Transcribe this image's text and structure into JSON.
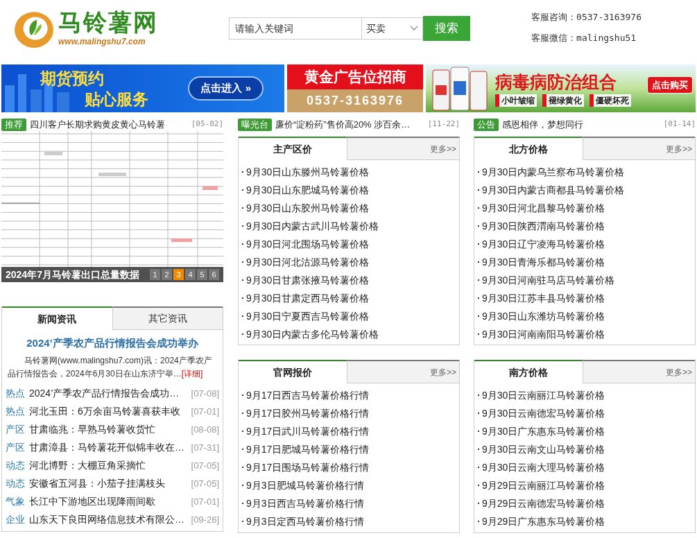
{
  "header": {
    "logo": {
      "name": "马铃薯网",
      "url": "www.malingshu7.com"
    },
    "search": {
      "placeholder": "请输入关键词",
      "category": "买卖",
      "button": "搜索"
    },
    "contact": [
      "客服咨询：0537-3163976",
      "客服微信：malingshu51"
    ]
  },
  "banners": [
    {
      "kind": "futures",
      "lines": [
        "期货预约",
        "贴心服务"
      ],
      "button": "点击进入 »"
    },
    {
      "kind": "ad",
      "title": "黄金广告位招商",
      "phone": "0537-3163976"
    },
    {
      "kind": "product",
      "title": "病毒病防治组合",
      "button": "点击购买",
      "tags": [
        "小叶皱缩",
        "褪绿黄化",
        "僵硬坏死"
      ]
    }
  ],
  "tickers": [
    {
      "tag": "推荐",
      "text": "四川客户长期求购黄皮黄心马铃薯",
      "date": "[05-02]"
    },
    {
      "tag": "曝光台",
      "text": "廉价“淀粉药”售价高20% 涉百余…",
      "date": "[11-22]"
    },
    {
      "tag": "公告",
      "text": "感恩相伴，梦想同行",
      "date": "[01-14]"
    }
  ],
  "slideshow": {
    "kind": "picture",
    "caption": "2024年7月马铃薯出口总量数据",
    "pages": [
      {
        "label": "1",
        "selected": false
      },
      {
        "label": "2",
        "selected": false
      },
      {
        "label": "3",
        "selected": true
      },
      {
        "label": "4",
        "selected": false
      },
      {
        "label": "5",
        "selected": false
      },
      {
        "label": "6",
        "selected": false
      }
    ]
  },
  "news_box": {
    "tabs": [
      {
        "label": "新闻资讯",
        "selected": true
      },
      {
        "label": "其它资讯",
        "selected": false
      }
    ],
    "headline": "2024’产季农产品行情报告会成功举办",
    "summary": "马铃薯网(www.malingshu7.com)讯：2024产季农产品行情报告会，2024年6月30日在山东济宁举…",
    "detail_link": "[详细]",
    "items": [
      {
        "tag": "热点",
        "title": "2024’产季农产品行情报告会成功…",
        "date": "[07-08]"
      },
      {
        "tag": "热点",
        "title": "河北玉田：6万余亩马铃薯喜获丰收",
        "date": "[07-01]"
      },
      {
        "tag": "产区",
        "title": "甘肃临兆：早熟马铃薯收货忙",
        "date": "[08-08]"
      },
      {
        "tag": "产区",
        "title": "甘肃漳县：马铃薯花开似锦丰收在…",
        "date": "[07-31]"
      },
      {
        "tag": "动态",
        "title": "河北博野：大棚豆角采摘忙",
        "date": "[07-05]"
      },
      {
        "tag": "动态",
        "title": "安徽省五河县：小茄子挂满枝头",
        "date": "[07-05]"
      },
      {
        "tag": "气象",
        "title": "长江中下游地区出现降雨间歇",
        "date": "[07-01]"
      },
      {
        "tag": "企业",
        "title": "山东天下良田网络信息技术有限公…",
        "date": "[09-26]"
      }
    ]
  },
  "price_panels": [
    {
      "title": "主产区价",
      "more": "更多>>",
      "items": [
        "9月30日山东滕州马铃薯价格",
        "9月30日山东肥城马铃薯价格",
        "9月30日山东胶州马铃薯价格",
        "9月30日内蒙古武川马铃薯价格",
        "9月30日河北围场马铃薯价格",
        "9月30日河北沽源马铃薯价格",
        "9月30日甘肃张掖马铃薯价格",
        "9月30日甘肃定西马铃薯价格",
        "9月30日宁夏西吉马铃薯价格",
        "9月30日内蒙古多伦马铃薯价格"
      ]
    },
    {
      "title": "北方价格",
      "more": "更多>>",
      "items": [
        "9月30日内蒙乌兰察布马铃薯价格",
        "9月30日内蒙古商都县马铃薯价格",
        "9月30日河北昌黎马铃薯价格",
        "9月30日陕西渭南马铃薯价格",
        "9月30日辽宁凌海马铃薯价格",
        "9月30日青海乐都马铃薯价格",
        "9月30日河南驻马店马铃薯价格",
        "9月30日江苏丰县马铃薯价格",
        "9月30日山东潍坊马铃薯价格",
        "9月30日河南南阳马铃薯价格"
      ]
    },
    {
      "title": "官网报价",
      "more": "更多>>",
      "items": [
        "9月17日西吉马铃薯价格行情",
        "9月17日胶州马铃薯价格行情",
        "9月17日武川马铃薯价格行情",
        "9月17日肥城马铃薯价格行情",
        "9月17日围场马铃薯价格行情",
        "9月3日肥城马铃薯价格行情",
        "9月3日西吉马铃薯价格行情",
        "9月3日定西马铃薯价格行情"
      ]
    },
    {
      "title": "南方价格",
      "more": "更多>>",
      "items": [
        "9月30日云南丽江马铃薯价格",
        "9月30日云南德宏马铃薯价格",
        "9月30日广东惠东马铃薯价格",
        "9月30日云南文山马铃薯价格",
        "9月30日云南大理马铃薯价格",
        "9月29日云南丽江马铃薯价格",
        "9月29日云南德宏马铃薯价格",
        "9月29日广东惠东马铃薯价格"
      ]
    }
  ]
}
